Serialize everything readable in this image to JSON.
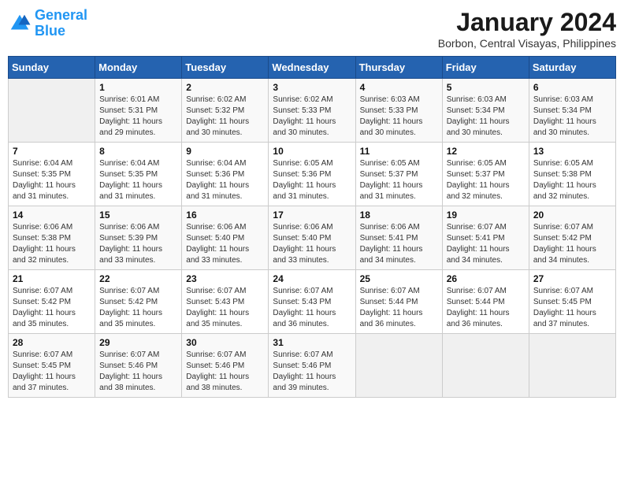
{
  "header": {
    "logo_line1": "General",
    "logo_line2": "Blue",
    "month_year": "January 2024",
    "location": "Borbon, Central Visayas, Philippines"
  },
  "weekdays": [
    "Sunday",
    "Monday",
    "Tuesday",
    "Wednesday",
    "Thursday",
    "Friday",
    "Saturday"
  ],
  "weeks": [
    [
      {
        "day": "",
        "info": ""
      },
      {
        "day": "1",
        "info": "Sunrise: 6:01 AM\nSunset: 5:31 PM\nDaylight: 11 hours\nand 29 minutes."
      },
      {
        "day": "2",
        "info": "Sunrise: 6:02 AM\nSunset: 5:32 PM\nDaylight: 11 hours\nand 30 minutes."
      },
      {
        "day": "3",
        "info": "Sunrise: 6:02 AM\nSunset: 5:33 PM\nDaylight: 11 hours\nand 30 minutes."
      },
      {
        "day": "4",
        "info": "Sunrise: 6:03 AM\nSunset: 5:33 PM\nDaylight: 11 hours\nand 30 minutes."
      },
      {
        "day": "5",
        "info": "Sunrise: 6:03 AM\nSunset: 5:34 PM\nDaylight: 11 hours\nand 30 minutes."
      },
      {
        "day": "6",
        "info": "Sunrise: 6:03 AM\nSunset: 5:34 PM\nDaylight: 11 hours\nand 30 minutes."
      }
    ],
    [
      {
        "day": "7",
        "info": "Sunrise: 6:04 AM\nSunset: 5:35 PM\nDaylight: 11 hours\nand 31 minutes."
      },
      {
        "day": "8",
        "info": "Sunrise: 6:04 AM\nSunset: 5:35 PM\nDaylight: 11 hours\nand 31 minutes."
      },
      {
        "day": "9",
        "info": "Sunrise: 6:04 AM\nSunset: 5:36 PM\nDaylight: 11 hours\nand 31 minutes."
      },
      {
        "day": "10",
        "info": "Sunrise: 6:05 AM\nSunset: 5:36 PM\nDaylight: 11 hours\nand 31 minutes."
      },
      {
        "day": "11",
        "info": "Sunrise: 6:05 AM\nSunset: 5:37 PM\nDaylight: 11 hours\nand 31 minutes."
      },
      {
        "day": "12",
        "info": "Sunrise: 6:05 AM\nSunset: 5:37 PM\nDaylight: 11 hours\nand 32 minutes."
      },
      {
        "day": "13",
        "info": "Sunrise: 6:05 AM\nSunset: 5:38 PM\nDaylight: 11 hours\nand 32 minutes."
      }
    ],
    [
      {
        "day": "14",
        "info": "Sunrise: 6:06 AM\nSunset: 5:38 PM\nDaylight: 11 hours\nand 32 minutes."
      },
      {
        "day": "15",
        "info": "Sunrise: 6:06 AM\nSunset: 5:39 PM\nDaylight: 11 hours\nand 33 minutes."
      },
      {
        "day": "16",
        "info": "Sunrise: 6:06 AM\nSunset: 5:40 PM\nDaylight: 11 hours\nand 33 minutes."
      },
      {
        "day": "17",
        "info": "Sunrise: 6:06 AM\nSunset: 5:40 PM\nDaylight: 11 hours\nand 33 minutes."
      },
      {
        "day": "18",
        "info": "Sunrise: 6:06 AM\nSunset: 5:41 PM\nDaylight: 11 hours\nand 34 minutes."
      },
      {
        "day": "19",
        "info": "Sunrise: 6:07 AM\nSunset: 5:41 PM\nDaylight: 11 hours\nand 34 minutes."
      },
      {
        "day": "20",
        "info": "Sunrise: 6:07 AM\nSunset: 5:42 PM\nDaylight: 11 hours\nand 34 minutes."
      }
    ],
    [
      {
        "day": "21",
        "info": "Sunrise: 6:07 AM\nSunset: 5:42 PM\nDaylight: 11 hours\nand 35 minutes."
      },
      {
        "day": "22",
        "info": "Sunrise: 6:07 AM\nSunset: 5:42 PM\nDaylight: 11 hours\nand 35 minutes."
      },
      {
        "day": "23",
        "info": "Sunrise: 6:07 AM\nSunset: 5:43 PM\nDaylight: 11 hours\nand 35 minutes."
      },
      {
        "day": "24",
        "info": "Sunrise: 6:07 AM\nSunset: 5:43 PM\nDaylight: 11 hours\nand 36 minutes."
      },
      {
        "day": "25",
        "info": "Sunrise: 6:07 AM\nSunset: 5:44 PM\nDaylight: 11 hours\nand 36 minutes."
      },
      {
        "day": "26",
        "info": "Sunrise: 6:07 AM\nSunset: 5:44 PM\nDaylight: 11 hours\nand 36 minutes."
      },
      {
        "day": "27",
        "info": "Sunrise: 6:07 AM\nSunset: 5:45 PM\nDaylight: 11 hours\nand 37 minutes."
      }
    ],
    [
      {
        "day": "28",
        "info": "Sunrise: 6:07 AM\nSunset: 5:45 PM\nDaylight: 11 hours\nand 37 minutes."
      },
      {
        "day": "29",
        "info": "Sunrise: 6:07 AM\nSunset: 5:46 PM\nDaylight: 11 hours\nand 38 minutes."
      },
      {
        "day": "30",
        "info": "Sunrise: 6:07 AM\nSunset: 5:46 PM\nDaylight: 11 hours\nand 38 minutes."
      },
      {
        "day": "31",
        "info": "Sunrise: 6:07 AM\nSunset: 5:46 PM\nDaylight: 11 hours\nand 39 minutes."
      },
      {
        "day": "",
        "info": ""
      },
      {
        "day": "",
        "info": ""
      },
      {
        "day": "",
        "info": ""
      }
    ]
  ]
}
